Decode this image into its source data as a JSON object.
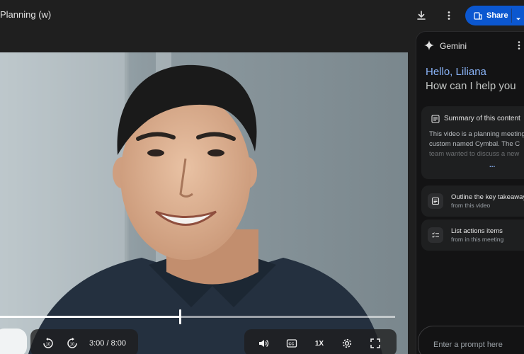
{
  "header": {
    "doc_title": "Planning (w)",
    "share_label": "Share",
    "icons": [
      "download-icon",
      "more-vert-icon",
      "people-icon",
      "caret-down-icon"
    ]
  },
  "video": {
    "time_label": "3:00 / 8:00",
    "progress": 0.455,
    "speed_label": "1X",
    "controls": [
      "play-pause",
      "rewind-10-icon",
      "forward-10-icon",
      "volume-icon",
      "captions-icon",
      "speed",
      "settings-icon",
      "fullscreen-icon"
    ]
  },
  "gemini": {
    "title": "Gemini",
    "greeting": "Hello, Liliana",
    "question": "How can I help you",
    "summary_card": {
      "title": "Summary of this content",
      "lines": [
        "This video is a planning meeting",
        "custom named Cymbal. The C",
        "team wanted to discuss a new"
      ],
      "more": "..."
    },
    "suggestions": [
      {
        "title": "Outline the key takeaways",
        "sub": "from this video"
      },
      {
        "title": "List actions items",
        "sub": "from in this meeting"
      }
    ],
    "prompt_placeholder": "Enter a prompt here"
  },
  "colors": {
    "background": "#1f1f1f",
    "panel": "#131314",
    "card": "#1e1f20",
    "accent_blue": "#0b57d0",
    "greeting_blue": "#8ab4f8"
  }
}
